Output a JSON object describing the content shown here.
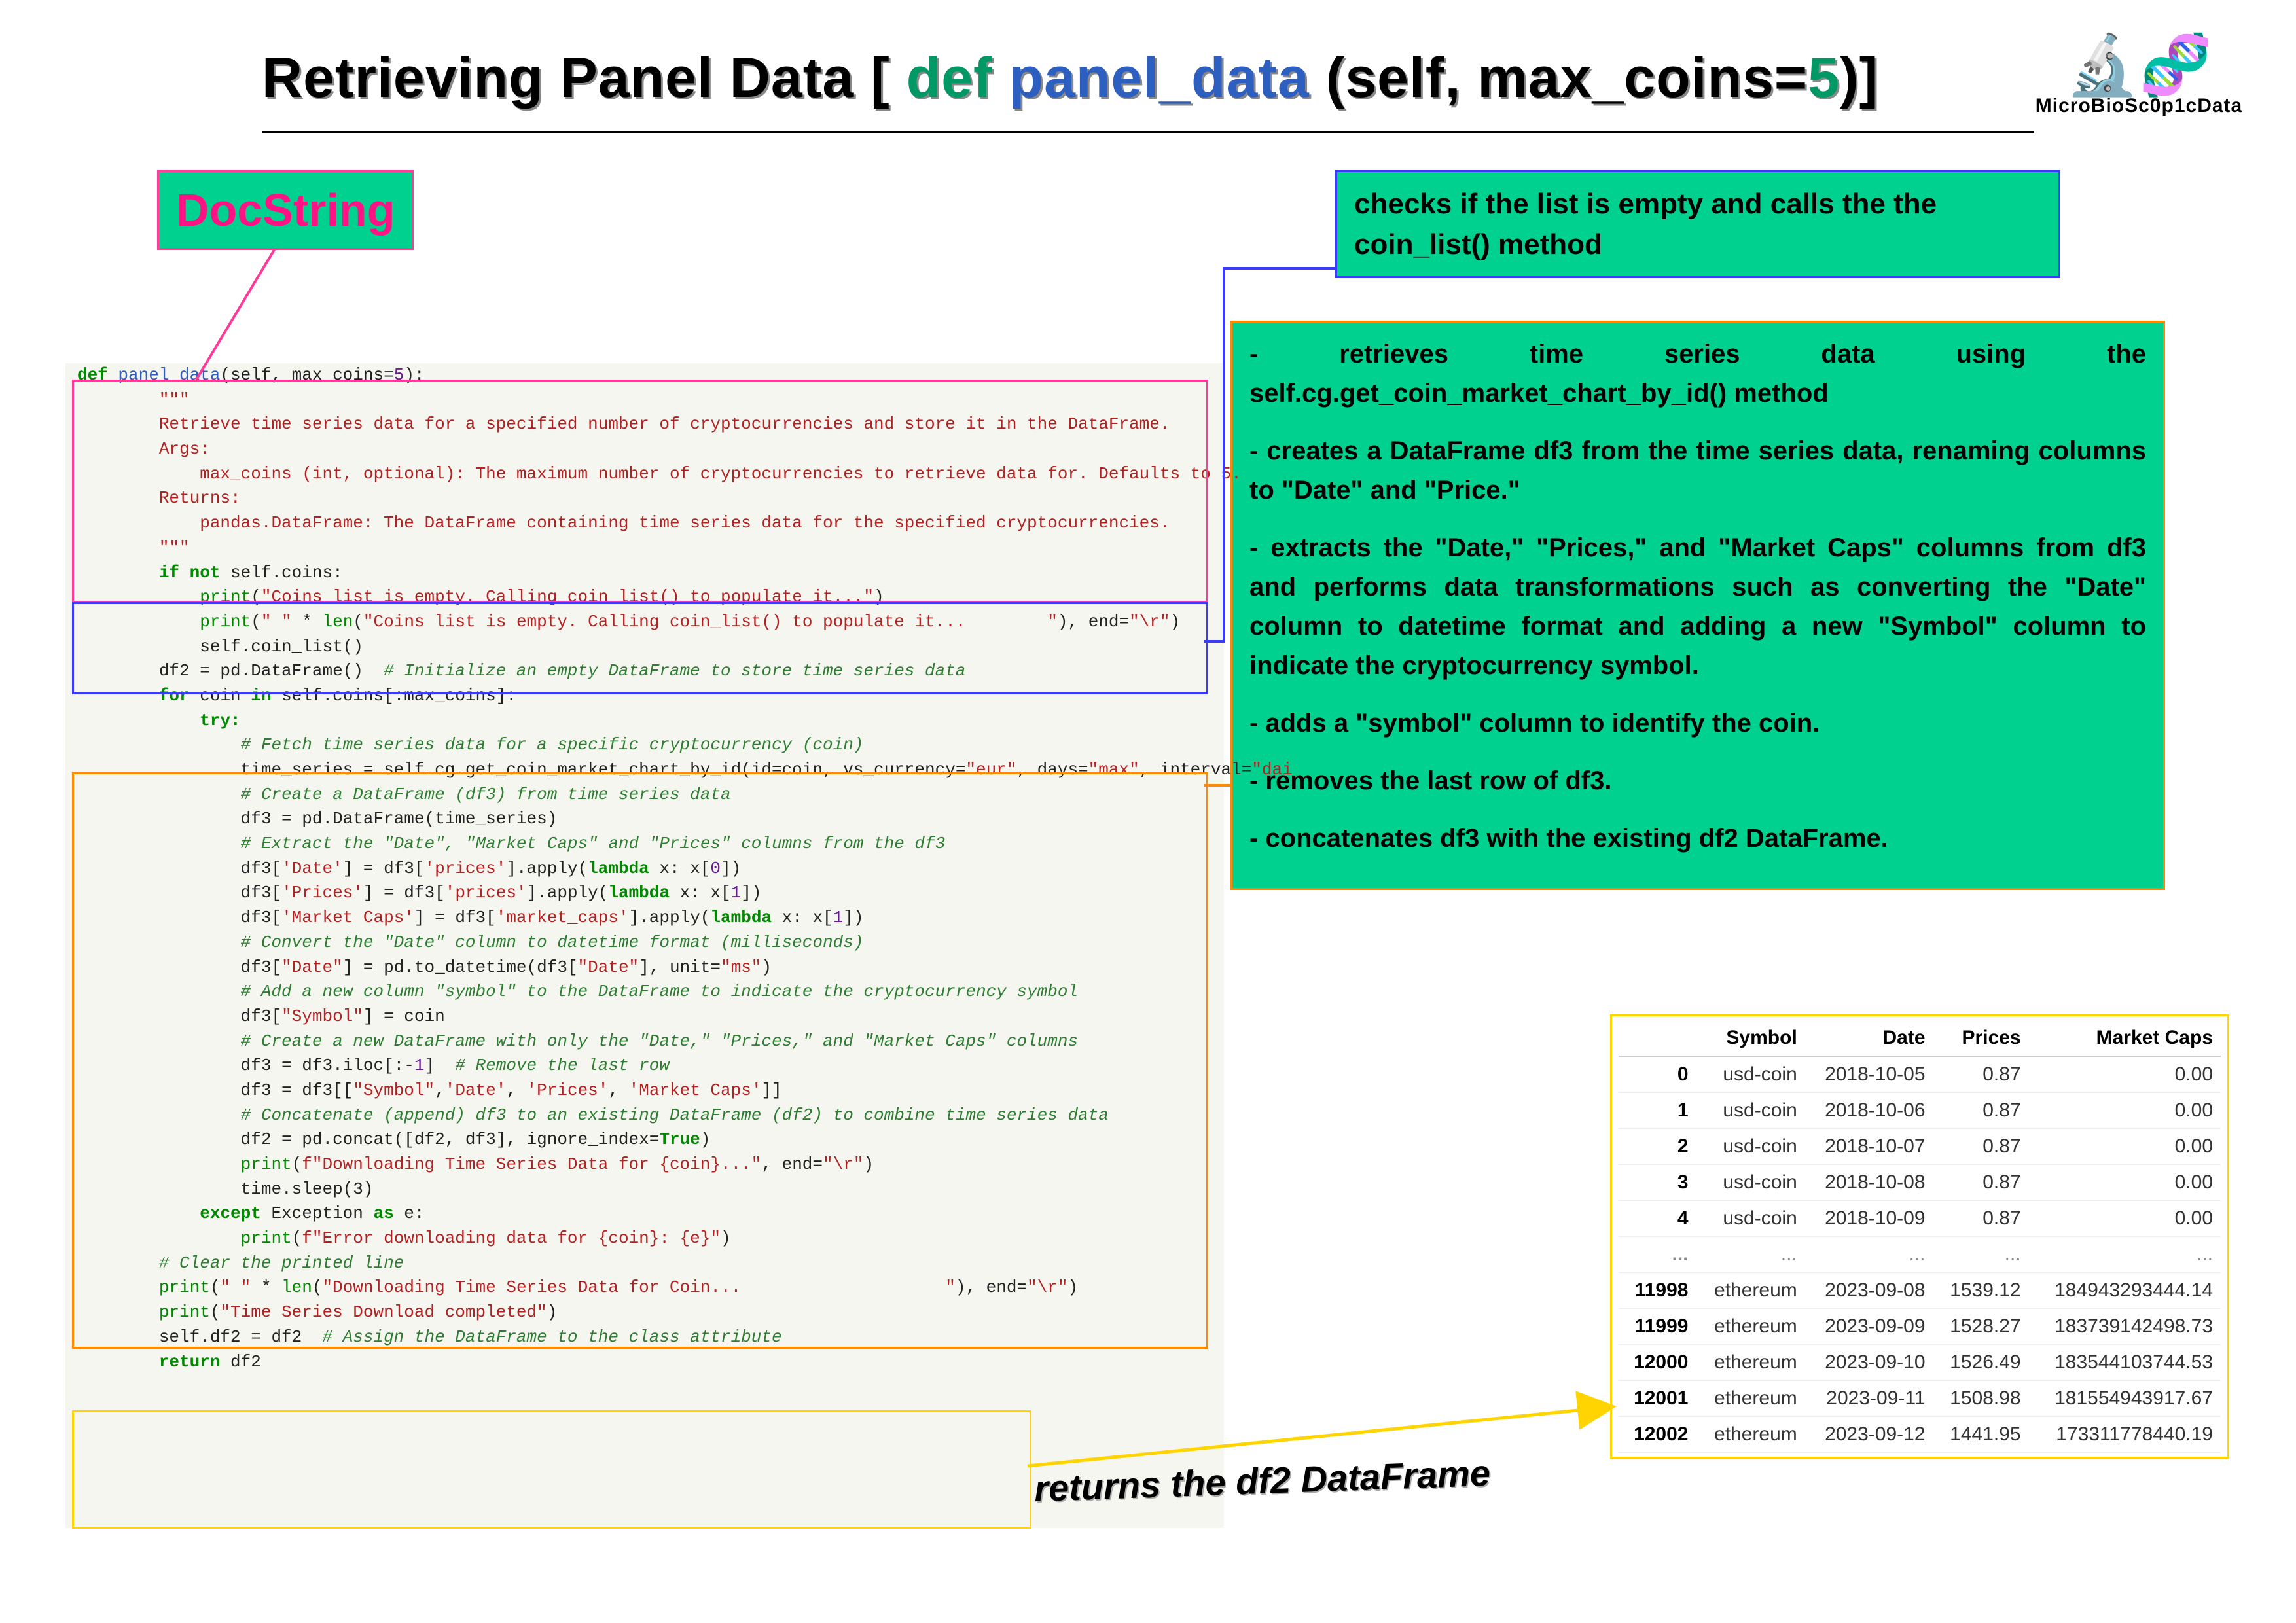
{
  "title": {
    "prefix": "Retrieving Panel Data [ ",
    "def": "def",
    "name": "panel_data",
    "mid": " (self, max_coins=",
    "num": "5",
    "suffix": ")]"
  },
  "brand": "MicroBioSc0p1cData",
  "callouts": {
    "docstring": "DocString",
    "check": "checks if the list is empty and calls the the coin_list() method",
    "loop": [
      "- retrieves time series data using the self.cg.get_coin_market_chart_by_id() method",
      "- creates a DataFrame df3 from the time series data, renaming columns to \"Date\" and \"Price.\"",
      "- extracts the \"Date,\" \"Prices,\" and \"Market Caps\" columns from df3 and performs data transformations such as converting the \"Date\" column to datetime format and adding a new \"Symbol\" column to indicate the cryptocurrency symbol.",
      "- adds a \"symbol\" column to identify the coin.",
      "- removes the last row of df3.",
      "- concatenates df3 with the existing df2 DataFrame."
    ],
    "returns": "returns the df2 DataFrame"
  },
  "code": {
    "l01a": "def ",
    "l01b": "panel_data",
    "l01c": "(self, max_coins=",
    "l01d": "5",
    "l01e": "):",
    "l02": "        \"\"\"",
    "l03": "        Retrieve time series data for a specified number of cryptocurrencies and store it in the DataFrame.",
    "l04": "",
    "l05": "        Args:",
    "l06": "            max_coins (int, optional): The maximum number of cryptocurrencies to retrieve data for. Defaults to 5.",
    "l07": "",
    "l08": "        Returns:",
    "l09": "            pandas.DataFrame: The DataFrame containing time series data for the specified cryptocurrencies.",
    "l10": "        \"\"\"",
    "l11a": "        ",
    "l11b": "if not ",
    "l11c": "self.coins:",
    "l12a": "            ",
    "l12b": "print",
    "l12c": "(",
    "l12d": "\"Coins list is empty. Calling coin_list() to populate it...\"",
    "l12e": ")",
    "l13a": "            ",
    "l13b": "print",
    "l13c": "(",
    "l13d": "\" \"",
    "l13e": " * ",
    "l13f": "len",
    "l13g": "(",
    "l13h": "\"Coins list is empty. Calling coin_list() to populate it...        \"",
    "l13i": "), end=",
    "l13j": "\"\\r\"",
    "l13k": ")",
    "l14": "",
    "l15": "            self.coin_list()",
    "l16": "",
    "l17a": "        df2 = pd.DataFrame()  ",
    "l17b": "# Initialize an empty DataFrame to store time series data",
    "l18": "",
    "l19a": "        ",
    "l19b": "for ",
    "l19c": "coin ",
    "l19d": "in ",
    "l19e": "self.coins[:max_coins]:",
    "l20a": "            ",
    "l20b": "try:",
    "l21": "                # Fetch time series data for a specific cryptocurrency (coin)",
    "l22a": "                time_series = self.cg.get_coin_market_chart_by_id(id=coin, vs_currency=",
    "l22b": "\"eur\"",
    "l22c": ", days=",
    "l22d": "\"max\"",
    "l22e": ", interval=",
    "l22f": "\"dai",
    "l23": "",
    "l24": "                # Create a DataFrame (df3) from time series data",
    "l25": "                df3 = pd.DataFrame(time_series)",
    "l26": "",
    "l27": "                # Extract the \"Date\", \"Market Caps\" and \"Prices\" columns from the df3",
    "l28a": "                df3[",
    "l28b": "'Date'",
    "l28c": "] = df3[",
    "l28d": "'prices'",
    "l28e": "].apply(",
    "l28f": "lambda",
    "l28g": " x: x[",
    "l28h": "0",
    "l28i": "])",
    "l29a": "                df3[",
    "l29b": "'Prices'",
    "l29c": "] = df3[",
    "l29d": "'prices'",
    "l29e": "].apply(",
    "l29f": "lambda",
    "l29g": " x: x[",
    "l29h": "1",
    "l29i": "])",
    "l30a": "                df3[",
    "l30b": "'Market Caps'",
    "l30c": "] = df3[",
    "l30d": "'market_caps'",
    "l30e": "].apply(",
    "l30f": "lambda",
    "l30g": " x: x[",
    "l30h": "1",
    "l30i": "])",
    "l31": "",
    "l32": "                # Convert the \"Date\" column to datetime format (milliseconds)",
    "l33a": "                df3[",
    "l33b": "\"Date\"",
    "l33c": "] = pd.to_datetime(df3[",
    "l33d": "\"Date\"",
    "l33e": "], unit=",
    "l33f": "\"ms\"",
    "l33g": ")",
    "l34": "",
    "l35": "                # Add a new column \"symbol\" to the DataFrame to indicate the cryptocurrency symbol",
    "l36a": "                df3[",
    "l36b": "\"Symbol\"",
    "l36c": "] = coin",
    "l37": "",
    "l38": "                # Create a new DataFrame with only the \"Date,\" \"Prices,\" and \"Market Caps\" columns",
    "l39a": "                df3 = df3.iloc[:-",
    "l39b": "1",
    "l39c": "]  ",
    "l39d": "# Remove the last row",
    "l40": "",
    "l41a": "                df3 = df3[[",
    "l41b": "\"Symbol\"",
    "l41c": ",",
    "l41d": "'Date'",
    "l41e": ", ",
    "l41f": "'Prices'",
    "l41g": ", ",
    "l41h": "'Market Caps'",
    "l41i": "]]",
    "l42": "",
    "l43": "                # Concatenate (append) df3 to an existing DataFrame (df2) to combine time series data",
    "l44a": "                df2 = pd.concat([df2, df3], ignore_index=",
    "l44b": "True",
    "l44c": ")",
    "l45a": "                ",
    "l45b": "print",
    "l45c": "(",
    "l45d": "f\"Downloading Time Series Data for {coin}...\"",
    "l45e": ", end=",
    "l45f": "\"\\r\"",
    "l45g": ")",
    "l46": "                time.sleep(3)",
    "l47": "",
    "l48a": "            ",
    "l48b": "except ",
    "l48c": "Exception ",
    "l48d": "as ",
    "l48e": "e:",
    "l49a": "                ",
    "l49b": "print",
    "l49c": "(",
    "l49d": "f\"Error downloading data for {coin}: {e}\"",
    "l49e": ")",
    "l50": "",
    "l51": "        # Clear the printed line",
    "l52a": "        ",
    "l52b": "print",
    "l52c": "(",
    "l52d": "\" \"",
    "l52e": " * ",
    "l52f": "len",
    "l52g": "(",
    "l52h": "\"Downloading Time Series Data for Coin...                    \"",
    "l52i": "), end=",
    "l52j": "\"\\r\"",
    "l52k": ")",
    "l53a": "        ",
    "l53b": "print",
    "l53c": "(",
    "l53d": "\"Time Series Download completed\"",
    "l53e": ")",
    "l54a": "        self.df2 = df2  ",
    "l54b": "# Assign the DataFrame to the class attribute",
    "l55a": "        ",
    "l55b": "return ",
    "l55c": "df2"
  },
  "df": {
    "headers": [
      "",
      "Symbol",
      "Date",
      "Prices",
      "Market Caps"
    ],
    "rows": [
      [
        "0",
        "usd-coin",
        "2018-10-05",
        "0.87",
        "0.00"
      ],
      [
        "1",
        "usd-coin",
        "2018-10-06",
        "0.87",
        "0.00"
      ],
      [
        "2",
        "usd-coin",
        "2018-10-07",
        "0.87",
        "0.00"
      ],
      [
        "3",
        "usd-coin",
        "2018-10-08",
        "0.87",
        "0.00"
      ],
      [
        "4",
        "usd-coin",
        "2018-10-09",
        "0.87",
        "0.00"
      ],
      [
        "...",
        "...",
        "...",
        "...",
        "..."
      ],
      [
        "11998",
        "ethereum",
        "2023-09-08",
        "1539.12",
        "184943293444.14"
      ],
      [
        "11999",
        "ethereum",
        "2023-09-09",
        "1528.27",
        "183739142498.73"
      ],
      [
        "12000",
        "ethereum",
        "2023-09-10",
        "1526.49",
        "183544103744.53"
      ],
      [
        "12001",
        "ethereum",
        "2023-09-11",
        "1508.98",
        "181554943917.67"
      ],
      [
        "12002",
        "ethereum",
        "2023-09-12",
        "1441.95",
        "173311778440.19"
      ]
    ]
  }
}
